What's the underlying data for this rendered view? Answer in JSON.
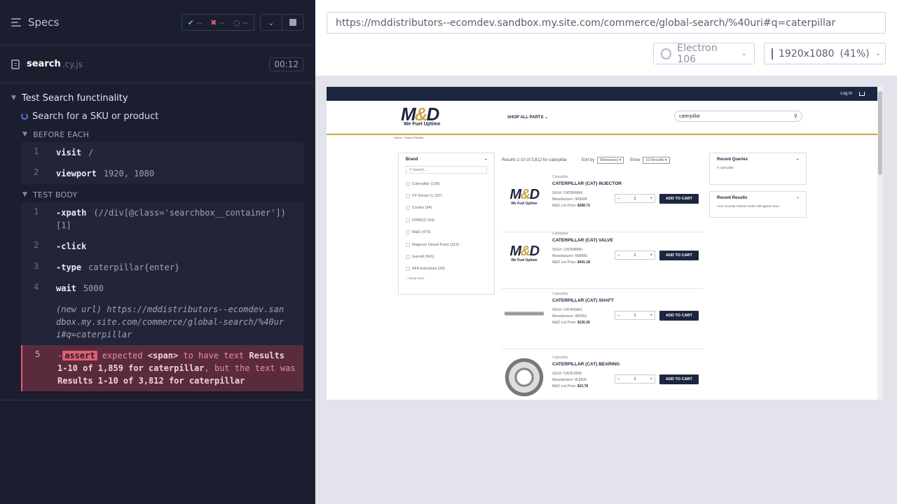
{
  "runner": {
    "specs_label": "Specs",
    "stats": {
      "passed": "--",
      "failed": "--",
      "pending": "--"
    },
    "spec": {
      "name": "search",
      "ext": ".cy.js",
      "duration": "00:12"
    },
    "suite_title": "Test Search functinality",
    "test_title": "Search for a SKU or product",
    "before_each_label": "BEFORE EACH",
    "test_body_label": "TEST BODY",
    "before_each": [
      {
        "num": "1",
        "name": "visit",
        "arg": "/"
      },
      {
        "num": "2",
        "name": "viewport",
        "arg": "1920, 1080"
      }
    ],
    "body": [
      {
        "num": "1",
        "name": "-xpath",
        "arg": "(//div[@class='searchbox__container'])",
        "arg2": "[1]"
      },
      {
        "num": "2",
        "name": "-click",
        "arg": ""
      },
      {
        "num": "3",
        "name": "-type",
        "arg": "caterpillar{enter}"
      },
      {
        "num": "4",
        "name": "wait",
        "arg": "5000"
      }
    ],
    "new_url": "(new url)  https://mddistributors--ecomdev.sandbox.my.site.com/commerce/global-search/%40uri#q=caterpillar",
    "error": {
      "num": "5",
      "tag": "assert",
      "expected": "expected",
      "el": "<span>",
      "to_have": "to have text",
      "wanted": "Results 1-10 of 1,859 for caterpillar",
      "but": ", but the text was",
      "actual": "Results 1-10 of 3,812 for caterpillar"
    }
  },
  "browser": {
    "url": "https://mddistributors--ecomdev.sandbox.my.site.com/commerce/global-search/%40uri#q=caterpillar",
    "name": "Electron 106",
    "viewport": "1920x1080",
    "scale": "(41%)"
  },
  "site": {
    "login": "Log In",
    "logo_tagline": "We Fuel Uptime",
    "shop_all": "SHOP ALL PARTS",
    "search_value": "caterpillar",
    "breadcrumb": "Home > Search Results",
    "facet_title": "Brand",
    "facet_search_placeholder": "Search...",
    "facets": [
      "Caterpillar (136)",
      "FP Diesel (1,197)",
      "Costex (94)",
      "DIPACO (34)",
      "M&D (475)",
      "Magnum Diesel Parts (313)",
      "Garrett (541)",
      "AFA Industries (29)"
    ],
    "show_more": "+ Show more",
    "results_text": "Results 1-10 of 3,812 for caterpillar",
    "sort_label": "Sort by",
    "sort_value": "Relevancy",
    "show_label": "Show",
    "show_value": "10 Results",
    "add_to_cart": "ADD TO CART",
    "products": [
      {
        "brand": "Caterpillar",
        "title": "CATERPILLAR (CAT) INJECTOR",
        "sku": "SKU#: CAT0R6684",
        "mfr": "Manufacturer: 0R6684",
        "price_label": "M&D List Price:",
        "price": "$298.72",
        "img": "logo"
      },
      {
        "brand": "Caterpillar",
        "title": "CATERPILLAR (CAT) VALVE",
        "sku": "SKU#: CAT5N8980",
        "mfr": "Manufacturer: 5N8980",
        "price_label": "M&D List Price:",
        "price": "$441.18",
        "img": "logo"
      },
      {
        "brand": "Caterpillar",
        "title": "CATERPILLAR (CAT) SHAFT",
        "sku": "SKU#: CAT4N0951",
        "mfr": "Manufacturer: 4N0951",
        "price_label": "M&D List Price:",
        "price": "$126.26",
        "img": "shaft"
      },
      {
        "brand": "Caterpillar",
        "title": "CATERPILLAR (CAT) BEARING",
        "sku": "SKU#: CAT8L8500",
        "mfr": "Manufacturer: 8L8500",
        "price_label": "M&D List Price:",
        "price": "$13.78",
        "img": "bearing"
      }
    ],
    "qty": "1",
    "recent_queries_title": "Recent Queries",
    "recent_query": "caterpillar",
    "recent_results_title": "Recent Results",
    "recent_results_text": "Your recently clicked results will appear here."
  }
}
